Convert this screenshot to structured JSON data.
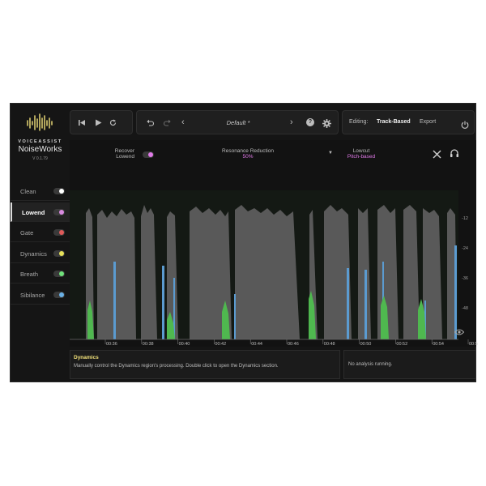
{
  "brand": {
    "subtitle": "VOICEASSIST",
    "name": "NoiseWorks",
    "version": "V 0.1.79"
  },
  "toolbar": {
    "preset_name": "Default *",
    "editing_label": "Editing:",
    "editing_mode": "Track-Based",
    "export_label": "Export"
  },
  "sidebar": {
    "items": [
      {
        "label": "Clean",
        "toggle_color": "#ffffff",
        "active": false
      },
      {
        "label": "Lowend",
        "toggle_color": "#d98ae0",
        "active": true
      },
      {
        "label": "Gate",
        "toggle_color": "#e05a5a",
        "active": false
      },
      {
        "label": "Dynamics",
        "toggle_color": "#e6e05a",
        "active": false
      },
      {
        "label": "Breath",
        "toggle_color": "#6fe07a",
        "active": false
      },
      {
        "label": "Sibilance",
        "toggle_color": "#6ab0e6",
        "active": false
      }
    ]
  },
  "controls": {
    "recover_label_1": "Recover",
    "recover_label_2": "Lowend",
    "resonance_label": "Resonance Reduction",
    "resonance_value": "50%",
    "lowcut_label": "Lowcut",
    "lowcut_value": "Pitch-based"
  },
  "timeline": {
    "ticks": [
      "00:36",
      "00:38",
      "00:40",
      "00:42",
      "00:44",
      "00:46",
      "00:48",
      "00:50",
      "00:52",
      "00:54",
      "00:5"
    ]
  },
  "db_scale": [
    "-12",
    "-24",
    "-36",
    "-48"
  ],
  "info": {
    "title": "Dynamics",
    "description": "Manually control the Dynamics region's processing. Double click to open the Dynamics section.",
    "analysis_status": "No analysis running."
  },
  "colors": {
    "accent_pink": "#e07ae8",
    "waveform_gray": "#5a5a5a",
    "breath_green": "#4fb84f",
    "sibilance_blue": "#5b9bd0",
    "editing_yellow": "#f2e27a"
  },
  "icons": [
    "logo-icon",
    "skip-back-icon",
    "play-icon",
    "loop-icon",
    "undo-icon",
    "redo-icon",
    "chevron-left-icon",
    "chevron-right-icon",
    "help-icon",
    "gear-icon",
    "power-icon",
    "close-icon",
    "headphones-icon",
    "eye-icon",
    "triangle-down-icon"
  ]
}
